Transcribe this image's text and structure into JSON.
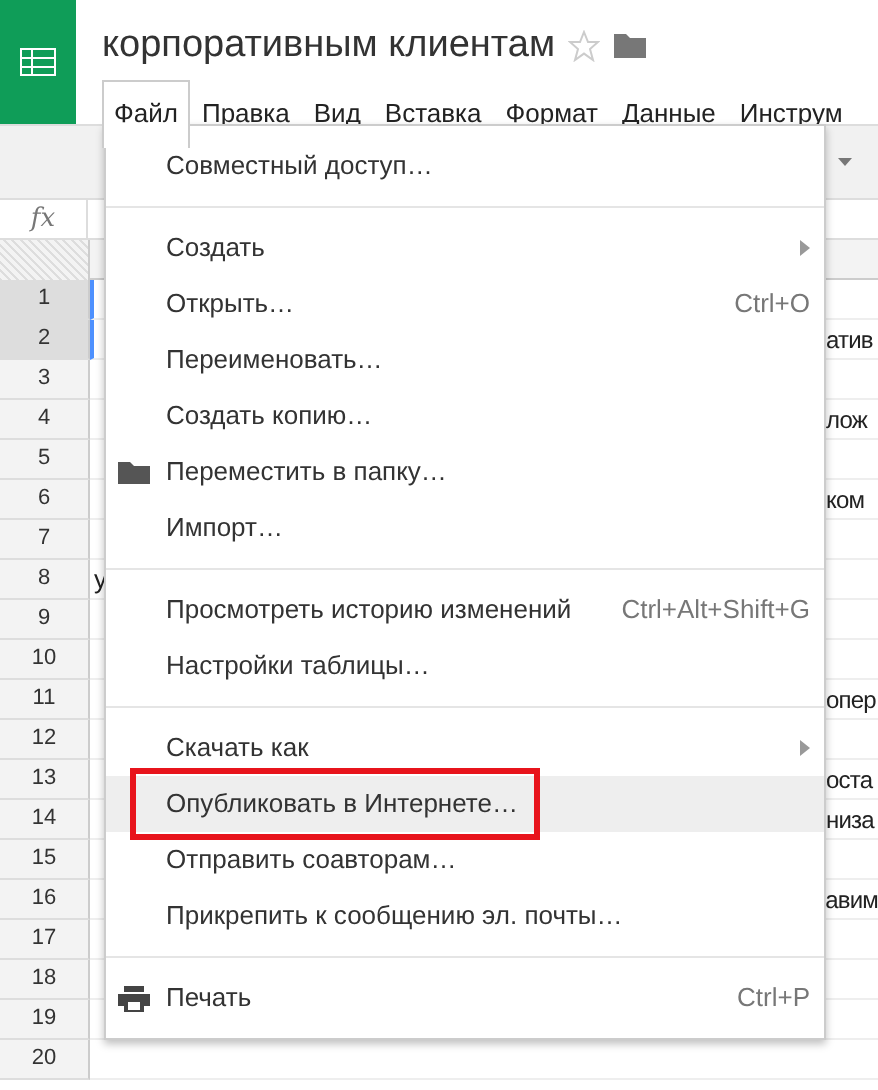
{
  "app": {
    "title": "корпоративным клиентам",
    "starred": false
  },
  "menubar": [
    {
      "label": "Файл",
      "selected": true
    },
    {
      "label": "Правка",
      "selected": false
    },
    {
      "label": "Вид",
      "selected": false
    },
    {
      "label": "Вставка",
      "selected": false
    },
    {
      "label": "Формат",
      "selected": false
    },
    {
      "label": "Данные",
      "selected": false
    },
    {
      "label": "Инструм",
      "selected": false
    }
  ],
  "formula_bar": {
    "label": "fx"
  },
  "grid": {
    "rows": [
      {
        "number": "1",
        "selected": true
      },
      {
        "number": "2",
        "selected": true,
        "cell_right": "атив"
      },
      {
        "number": "3",
        "selected": false
      },
      {
        "number": "4",
        "selected": false,
        "cell_right": "лож"
      },
      {
        "number": "5",
        "selected": false
      },
      {
        "number": "6",
        "selected": false,
        "cell_right": "ком"
      },
      {
        "number": "7",
        "selected": false
      },
      {
        "number": "8",
        "selected": false,
        "cell_left": "у"
      },
      {
        "number": "9",
        "selected": false
      },
      {
        "number": "10",
        "selected": false
      },
      {
        "number": "11",
        "selected": false,
        "cell_right": "опер"
      },
      {
        "number": "12",
        "selected": false
      },
      {
        "number": "13",
        "selected": false,
        "cell_right": "оста"
      },
      {
        "number": "14",
        "selected": false,
        "cell_right": "низа"
      },
      {
        "number": "15",
        "selected": false
      },
      {
        "number": "16",
        "selected": false,
        "cell_right": "авим"
      },
      {
        "number": "17",
        "selected": false
      },
      {
        "number": "18",
        "selected": false
      },
      {
        "number": "19",
        "selected": false
      },
      {
        "number": "20",
        "selected": false
      }
    ]
  },
  "file_menu": {
    "items": [
      {
        "kind": "item",
        "label": "Совместный доступ…",
        "submenu": false,
        "selected": false
      },
      {
        "kind": "separator"
      },
      {
        "kind": "item",
        "label": "Создать",
        "submenu": true,
        "selected": false
      },
      {
        "kind": "item",
        "label": "Открыть…",
        "shortcut": "Ctrl+O",
        "submenu": false,
        "selected": false
      },
      {
        "kind": "item",
        "label": "Переименовать…",
        "submenu": false,
        "selected": false
      },
      {
        "kind": "item",
        "label": "Создать копию…",
        "submenu": false,
        "selected": false
      },
      {
        "kind": "folder_item",
        "label": "Переместить в папку…",
        "submenu": false,
        "selected": false
      },
      {
        "kind": "item",
        "label": "Импорт…",
        "submenu": false,
        "selected": false
      },
      {
        "kind": "separator"
      },
      {
        "kind": "item",
        "label": "Просмотреть историю изменений",
        "shortcut": "Ctrl+Alt+Shift+G",
        "submenu": false,
        "selected": false
      },
      {
        "kind": "item",
        "label": "Настройки таблицы…",
        "submenu": false,
        "selected": false
      },
      {
        "kind": "separator"
      },
      {
        "kind": "item",
        "label": "Скачать как",
        "submenu": true,
        "selected": false
      },
      {
        "kind": "item",
        "label": "Опубликовать в Интернете…",
        "submenu": false,
        "selected": true,
        "outlined": true
      },
      {
        "kind": "item",
        "label": "Отправить соавторам…",
        "submenu": false,
        "selected": false
      },
      {
        "kind": "item",
        "label": "Прикрепить к сообщению эл. почты…",
        "submenu": false,
        "selected": false
      },
      {
        "kind": "separator"
      },
      {
        "kind": "printer_item",
        "label": "Печать",
        "shortcut": "Ctrl+P",
        "submenu": false,
        "selected": false
      }
    ]
  }
}
